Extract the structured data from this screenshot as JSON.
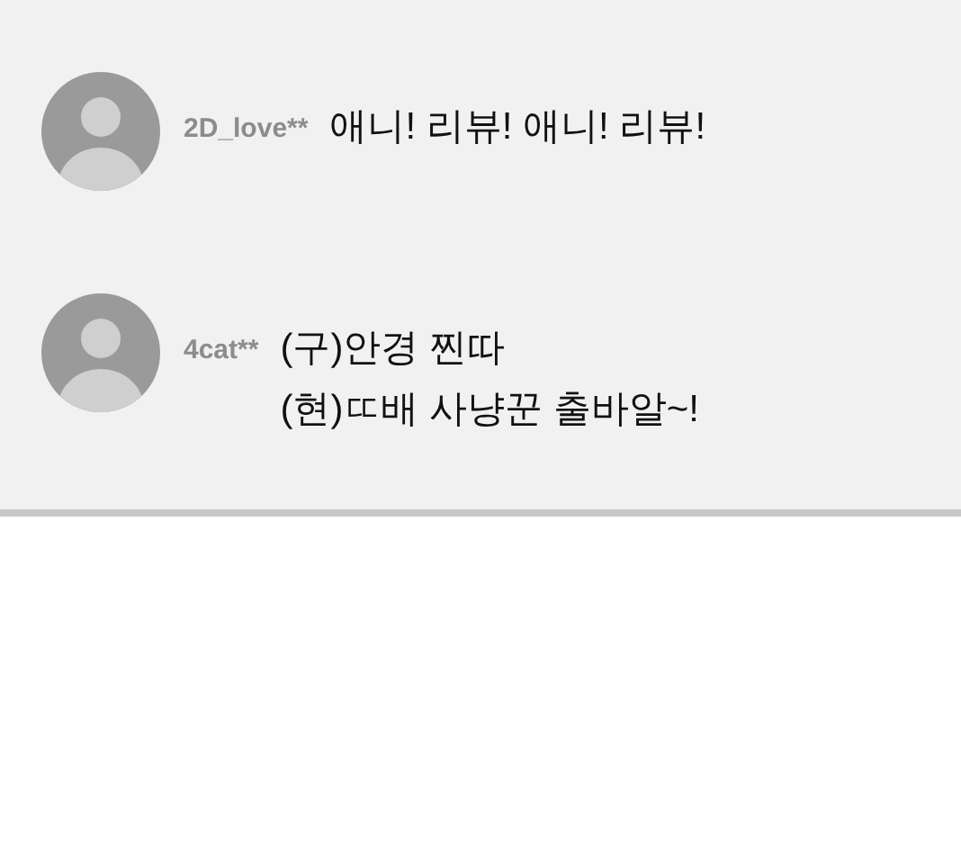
{
  "comments": [
    {
      "username": "2D_love**",
      "lines": [
        "애니! 리뷰! 애니! 리뷰!"
      ]
    },
    {
      "username": "4cat**",
      "lines": [
        "(구)안경 찐따",
        "(현)ㄸ배 사냥꾼 출바알~!"
      ]
    }
  ]
}
